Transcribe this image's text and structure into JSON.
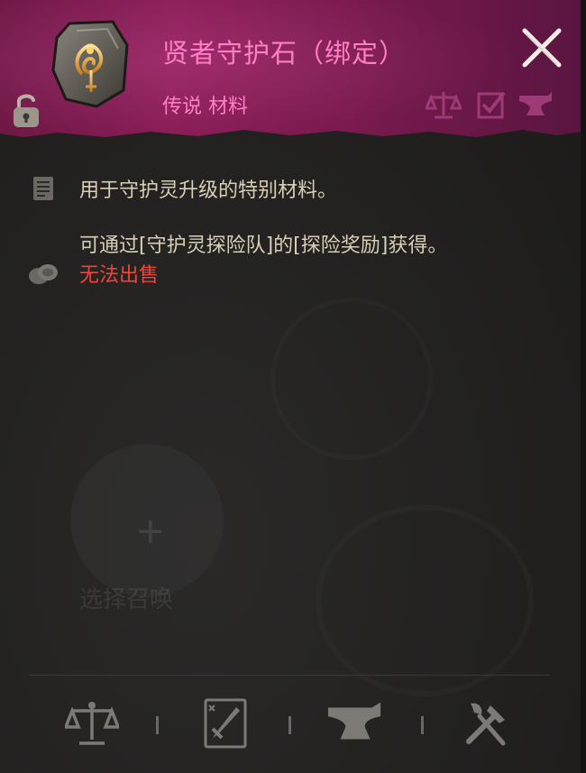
{
  "header": {
    "title": "贤者守护石（绑定）",
    "subtitle": "传说 材料",
    "accent_color": "#ff7ec6",
    "background_color": "#7a1a4e",
    "icons": [
      "balance-scale-icon",
      "checkbox-icon",
      "anvil-icon"
    ]
  },
  "body": {
    "description": "用于守护灵升级的特别材料。",
    "source": "可通过[守护灵探险队]的[探险奖励]获得。",
    "restriction": "无法出售",
    "restriction_color": "#f0443a"
  },
  "background_ghost": {
    "slot_label": "选择召唤"
  },
  "bottom_bar": {
    "buttons": [
      "sell-icon",
      "equip-sword-icon",
      "anvil-icon",
      "tools-icon"
    ]
  }
}
